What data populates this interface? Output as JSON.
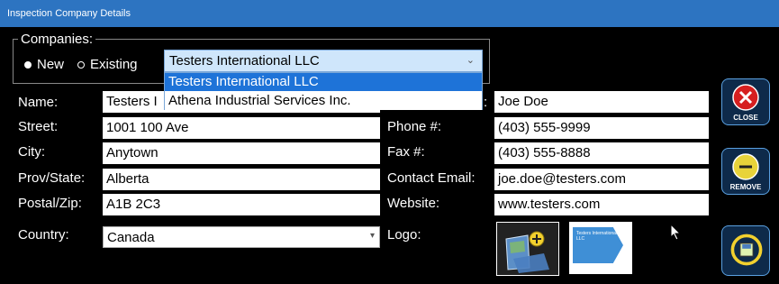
{
  "window": {
    "title": "Inspection Company Details"
  },
  "companies": {
    "legend": "Companies:",
    "radio_new": "New",
    "radio_existing": "Existing",
    "selected": "Testers International LLC",
    "options": [
      "Testers International LLC",
      "Athena Industrial Services Inc."
    ]
  },
  "labels": {
    "name": "Name:",
    "street": "Street:",
    "city": "City:",
    "prov": "Prov/State:",
    "postal": "Postal/Zip:",
    "country": "Country:",
    "phone": "Phone #:",
    "fax": "Fax #:",
    "email": "Contact Email:",
    "website": "Website:",
    "logo": "Logo:"
  },
  "values": {
    "name": "Testers I",
    "street": "1001 100 Ave",
    "city": "Anytown",
    "prov": "Alberta",
    "postal": "A1B 2C3",
    "country": "Canada",
    "contact": "Joe Doe",
    "phone": "(403) 555-9999",
    "fax": "(403) 555-8888",
    "email": "joe.doe@testers.com",
    "website": "www.testers.com"
  },
  "buttons": {
    "close": "CLOSE",
    "remove": "REMOVE"
  },
  "logo_thumb_text": "Testers International LLC",
  "colors": {
    "titlebar": "#2d74c1",
    "selection": "#1e73d8",
    "close_red": "#d61f1f",
    "remove_yellow": "#e8d33a"
  },
  "icons": {
    "close": "close-icon",
    "remove": "remove-icon",
    "save": "save-icon",
    "add_logo": "add-logo-icon"
  }
}
